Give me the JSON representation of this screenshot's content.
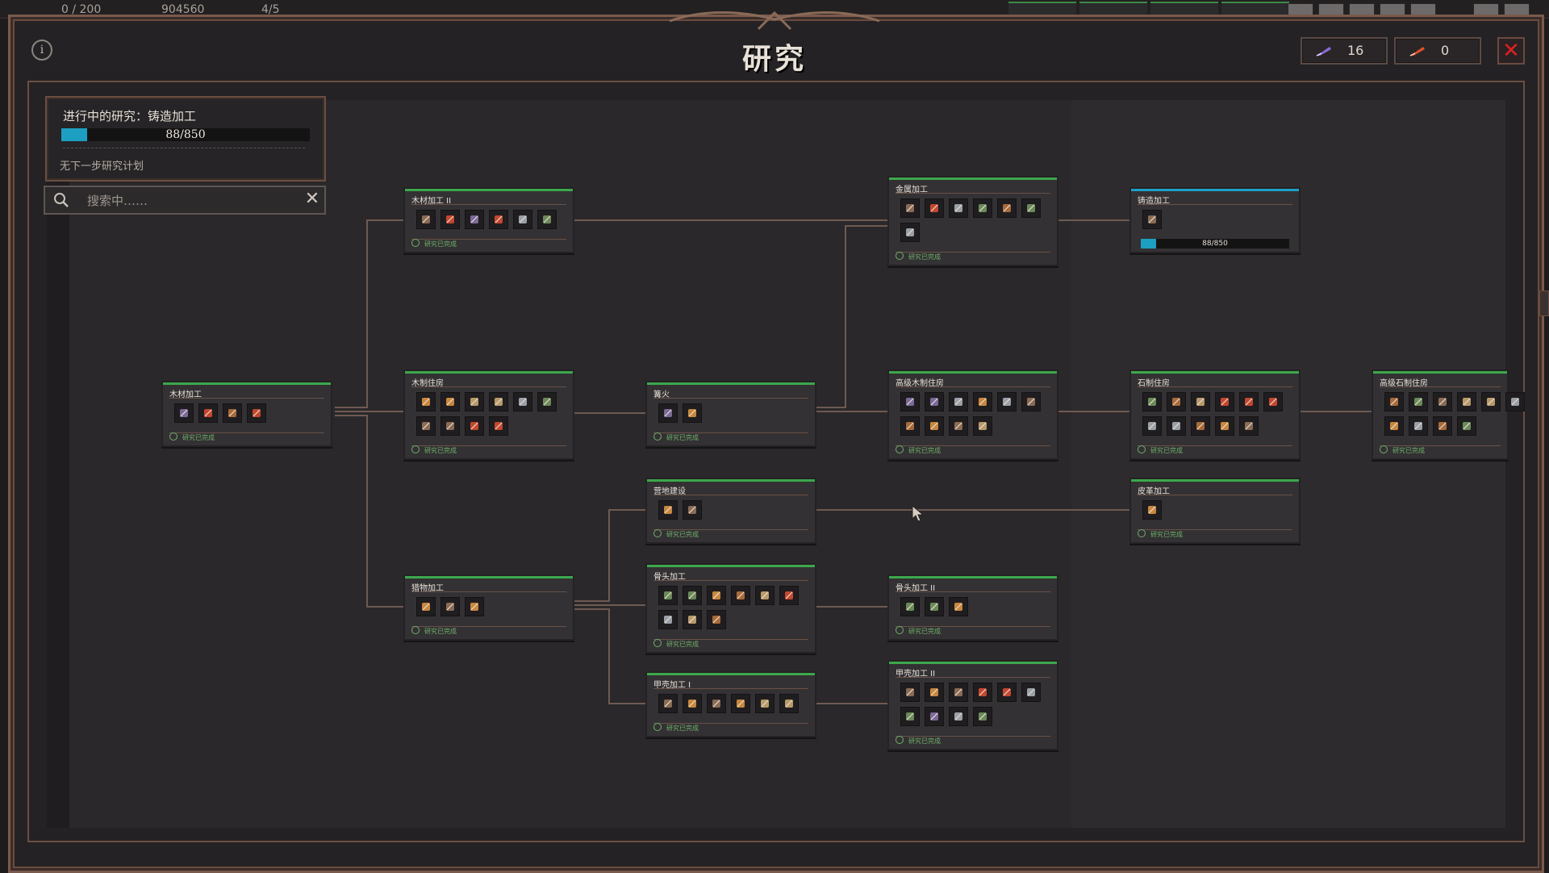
{
  "hud": {
    "pop": "0 / 200",
    "money": "904560",
    "workers": "4/5",
    "tabs": [
      "",
      "",
      "",
      ""
    ]
  },
  "window": {
    "title": "研究",
    "currency": [
      {
        "icon": "purple-quill-icon",
        "value": "16",
        "color": "#8c6ad8"
      },
      {
        "icon": "red-quill-icon",
        "value": "0",
        "color": "#e0502a"
      }
    ]
  },
  "current_research": {
    "label": "进行中的研究：铸造加工",
    "progress_text": "88/850",
    "progress": 0.1035,
    "next_plan": "无下一步研究计划"
  },
  "search": {
    "placeholder": "搜索中……",
    "value": ""
  },
  "status_done": "研究已完成",
  "colors": {
    "done_bar": "#3ca84c",
    "active_bar": "#1ea0c8",
    "frame": "#7a5a4c"
  },
  "nodes": [
    {
      "id": "wood",
      "title": "木材加工",
      "icons": [
        "fire-pit-icon",
        "plank-icon",
        "workbench-icon",
        "wood-bundle-icon"
      ],
      "status": "研究已完成"
    },
    {
      "id": "wood2",
      "title": "木材加工 II",
      "icons": [
        "plank-icon",
        "stick-icon",
        "barrel-icon",
        "log-icon",
        "spear-icon",
        "crate-icon"
      ],
      "status": "研究已完成"
    },
    {
      "id": "woodhouse",
      "title": "木制住房",
      "icons": [
        "door-icon",
        "bed-icon",
        "table-icon",
        "lamp-icon",
        "chair-icon",
        "stool-icon",
        "cabinet-icon",
        "pillar-icon",
        "barrel-icon",
        "shelf-icon"
      ],
      "status": "研究已完成"
    },
    {
      "id": "hunt",
      "title": "猎物加工",
      "icons": [
        "rack-icon",
        "pole-icon",
        "hide-frame-icon"
      ],
      "status": "研究已完成"
    },
    {
      "id": "campfire",
      "title": "篝火",
      "icons": [
        "campfire-icon",
        "pot-icon"
      ],
      "status": "研究已完成"
    },
    {
      "id": "camp",
      "title": "营地建设",
      "icons": [
        "tent-icon",
        "rock-icon"
      ],
      "status": "研究已完成"
    },
    {
      "id": "bone",
      "title": "骨头加工",
      "icons": [
        "bone-knife-icon",
        "bone-club-icon",
        "bone-spear-icon",
        "bone-axe-icon",
        "bone-dagger-icon",
        "bone-pick-icon",
        "bone-hammer-icon",
        "bone-hoe-icon",
        "bone-sickle-icon"
      ],
      "status": "研究已完成"
    },
    {
      "id": "shell1",
      "title": "甲壳加工 I",
      "icons": [
        "shell-icon",
        "shell-armor-icon",
        "shell-blade-icon",
        "shell-axe-icon",
        "shell-spear-icon",
        "shell-pick-icon"
      ],
      "status": "研究已完成"
    },
    {
      "id": "metal",
      "title": "金属加工",
      "icons": [
        "anvil-icon",
        "forge-icon",
        "bellows-icon",
        "furnace-icon",
        "smelter-icon",
        "mould-icon",
        "pot-icon"
      ],
      "status": "研究已完成"
    },
    {
      "id": "advwood",
      "title": "高级木制住房",
      "icons": [
        "wardrobe-icon",
        "dresser-icon",
        "cabinet-icon",
        "bookshelf-icon",
        "chest-icon",
        "painting-icon",
        "stool-icon",
        "bench-icon",
        "shelf-icon",
        "candle-icon"
      ],
      "status": "研究已完成"
    },
    {
      "id": "bone2",
      "title": "骨头加工 II",
      "icons": [
        "bone-totem-icon",
        "bone-star-icon",
        "bone-skull-icon"
      ],
      "status": "研究已完成"
    },
    {
      "id": "shell2",
      "title": "甲壳加工 II",
      "icons": [
        "shell-icon",
        "shell-blade-icon",
        "shell-spear-icon",
        "shell-sword-icon",
        "shell-pick-icon",
        "shell-hammer-icon",
        "shell-dagger-icon",
        "shell-axe-icon",
        "shell-rod-icon",
        "shell-hoe-icon"
      ],
      "status": "研究已完成"
    },
    {
      "id": "casting",
      "title": "铸造加工",
      "icons": [
        "casting-mould-icon"
      ],
      "status": "",
      "progress_text": "88/850",
      "progress": 0.1035
    },
    {
      "id": "stonehouse",
      "title": "石制住房",
      "icons": [
        "stone-bath-icon",
        "stone-door-icon",
        "stone-cabinet-icon",
        "stone-block-icon",
        "stone-tile-icon",
        "stone-bed-icon",
        "stone-table-icon",
        "stone-lamp-icon",
        "stone-stool-icon",
        "stone-shelf-icon",
        "stone-bench-icon"
      ],
      "status": "研究已完成"
    },
    {
      "id": "leather",
      "title": "皮革加工",
      "icons": [
        "leather-rack-icon"
      ],
      "status": "研究已完成"
    },
    {
      "id": "advstone",
      "title": "高级石制住房",
      "icons": [
        "stone-altar-icon",
        "stone-bed-icon",
        "stone-basin-icon",
        "stone-pillar-icon",
        "stone-bench-icon",
        "stone-statue-icon",
        "stone-fountain-icon",
        "stone-lamp-icon",
        "stone-table-icon",
        "stone-urn-icon"
      ],
      "status": "研究已完成"
    }
  ]
}
